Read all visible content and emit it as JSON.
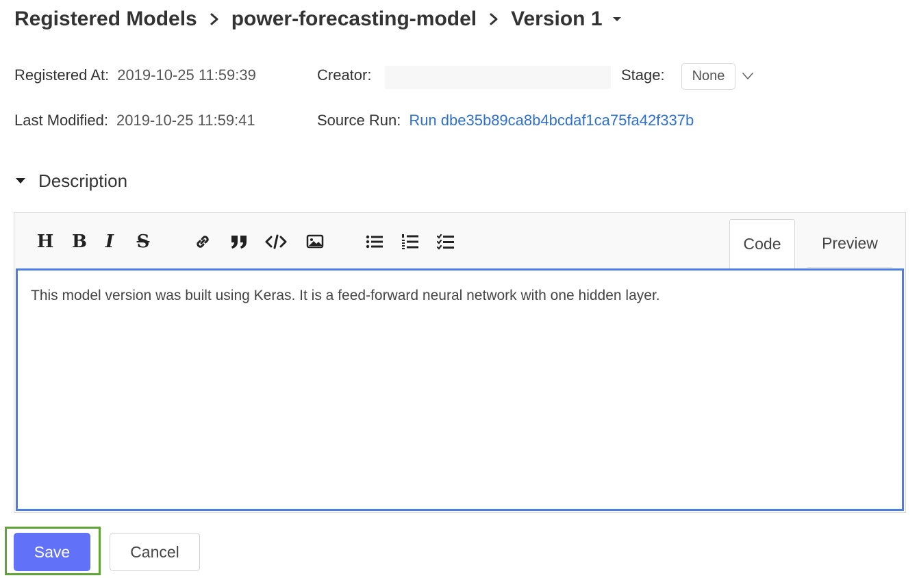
{
  "breadcrumb": {
    "root": "Registered Models",
    "model": "power-forecasting-model",
    "version": "Version 1"
  },
  "meta": {
    "registered_at_label": "Registered At",
    "registered_at_value": "2019-10-25 11:59:39",
    "last_modified_label": "Last Modified",
    "last_modified_value": "2019-10-25 11:59:41",
    "creator_label": "Creator",
    "stage_label": "Stage",
    "stage_value": "None",
    "source_run_label": "Source Run",
    "source_run_value": "Run dbe35b89ca8b4bcdaf1ca75fa42f337b",
    "colon": ":"
  },
  "description": {
    "toggle_label": "Description",
    "text": "This model version was built using Keras. It is a feed-forward neural network with one hidden layer."
  },
  "editor": {
    "tabs": {
      "code": "Code",
      "preview": "Preview"
    },
    "toolbar": {
      "header": "H",
      "bold": "B",
      "italic": "I",
      "strikethrough": "S"
    }
  },
  "actions": {
    "save": "Save",
    "cancel": "Cancel"
  },
  "colors": {
    "link": "#2e6fd1",
    "primary_button": "#6272f8",
    "editor_focus_border": "#4a7fdf",
    "highlight": "#5fa536"
  }
}
